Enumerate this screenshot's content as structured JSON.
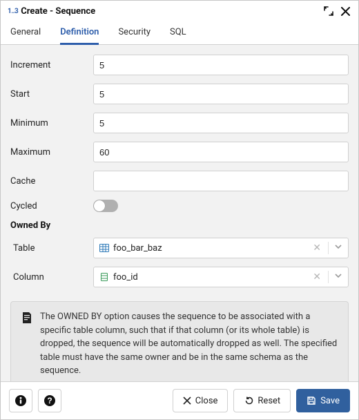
{
  "header": {
    "icon_text": "1..3",
    "title": "Create - Sequence"
  },
  "tabs": [
    {
      "label": "General",
      "active": false
    },
    {
      "label": "Definition",
      "active": true
    },
    {
      "label": "Security",
      "active": false
    },
    {
      "label": "SQL",
      "active": false
    }
  ],
  "fields": {
    "increment": {
      "label": "Increment",
      "value": "5"
    },
    "start": {
      "label": "Start",
      "value": "5"
    },
    "minimum": {
      "label": "Minimum",
      "value": "5"
    },
    "maximum": {
      "label": "Maximum",
      "value": "60"
    },
    "cache": {
      "label": "Cache",
      "value": ""
    },
    "cycled": {
      "label": "Cycled",
      "value": false
    }
  },
  "owned_by": {
    "heading": "Owned By",
    "table": {
      "label": "Table",
      "value": "foo_bar_baz"
    },
    "column": {
      "label": "Column",
      "value": "foo_id"
    }
  },
  "info_text": "The OWNED BY option causes the sequence to be associated with a specific table column, such that if that column (or its whole table) is dropped, the sequence will be automatically dropped as well. The specified table must have the same owner and be in the same schema as the sequence.",
  "footer": {
    "close": "Close",
    "reset": "Reset",
    "save": "Save"
  }
}
